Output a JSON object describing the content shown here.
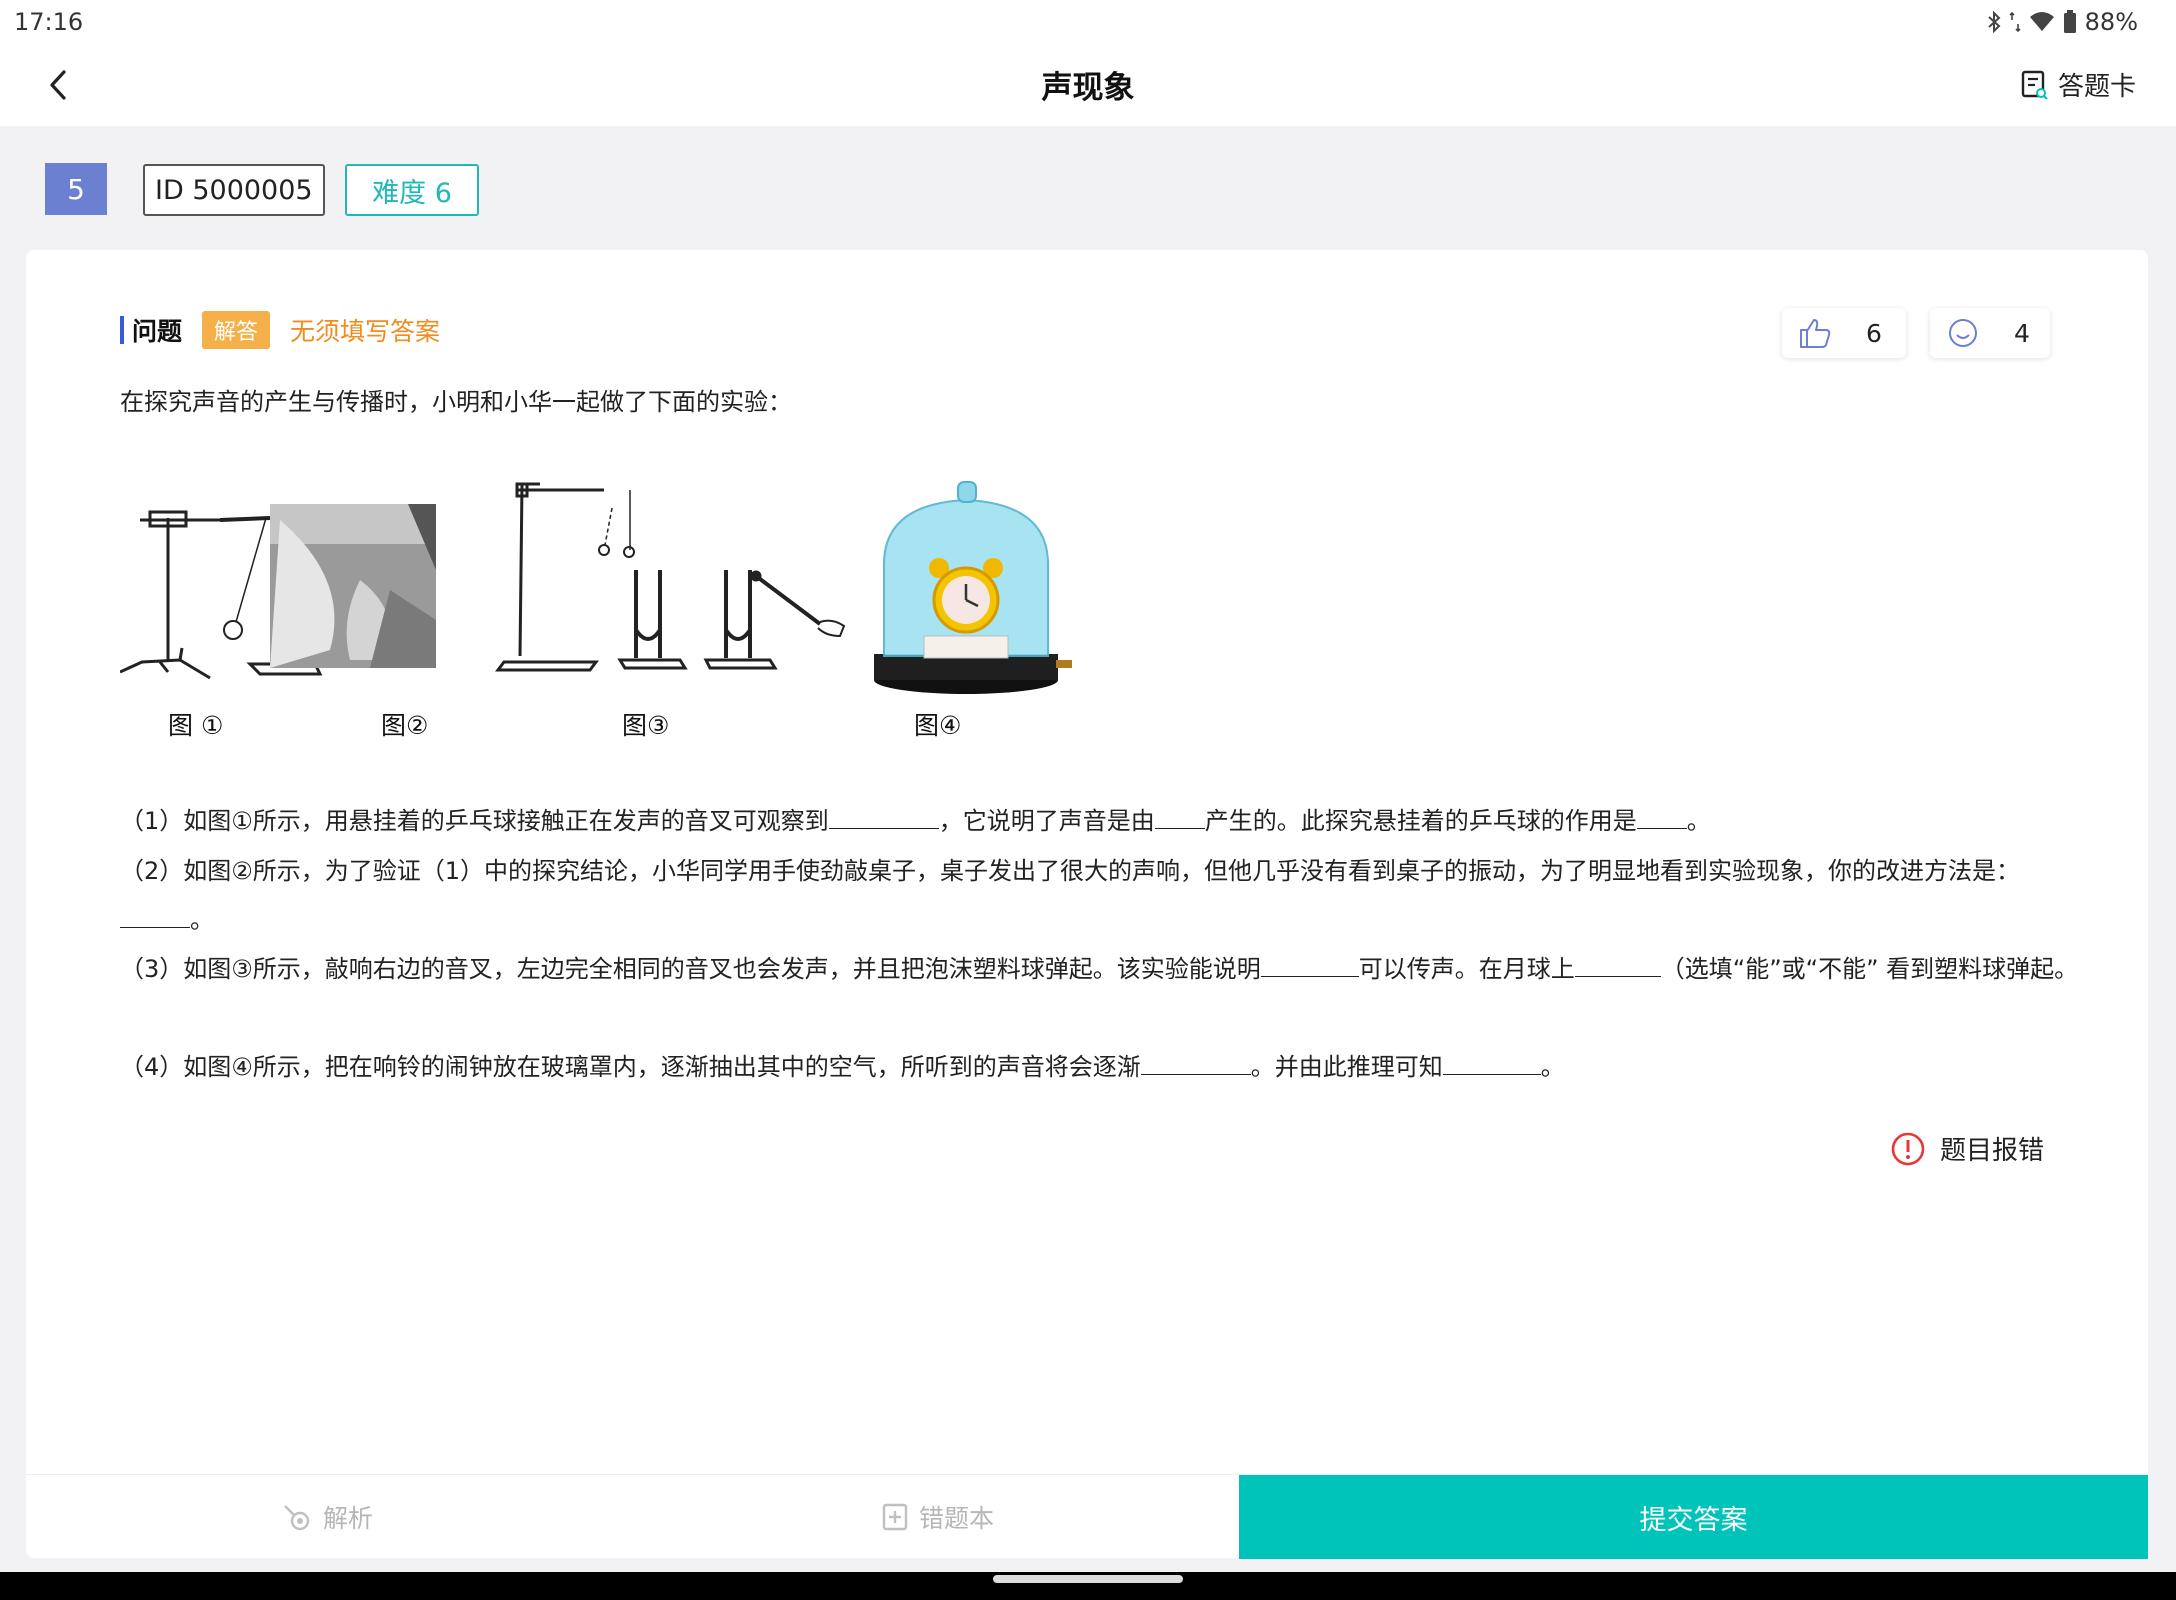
{
  "status_bar": {
    "time": "17:16",
    "battery": "88%"
  },
  "header": {
    "title": "声现象",
    "answer_card_label": "答题卡"
  },
  "meta": {
    "number": "5",
    "id_label": "ID 5000005",
    "difficulty_label": "难度 6"
  },
  "question": {
    "section_label": "问题",
    "type_tag": "解答",
    "note": "无须填写答案",
    "likes": "6",
    "reactions": "4",
    "intro": "在探究声音的产生与传播时，小明和小华一起做了下面的实验：",
    "figure_captions": [
      "图 ①",
      "图②",
      "图③",
      "图④"
    ],
    "parts": {
      "p1": {
        "a": "（1）如图①所示，用悬挂着的乒乓球接触正在发声的音叉可观察到",
        "b": "，它说明了声音是由",
        "c": "产生的。此探究悬挂着的乒乓球的作用是",
        "d": "。"
      },
      "p2": {
        "a": "（2）如图②所示，为了验证（1）中的探究结论，小华同学用手使劲敲桌子，桌子发出了很大的声响，但他几乎没有看到桌子的振动，为了明显地看到实验现象，你的改进方法是：",
        "b": "。"
      },
      "p3": {
        "a": "（3）如图③所示，敲响右边的音叉，左边完全相同的音叉也会发声，并且把泡沫塑料球弹起。该实验能说明",
        "b": "可以传声。在月球上",
        "c": "（选填“能”或“不能” 看到塑料球弹起。"
      },
      "p4": {
        "a": "（4）如图④所示，把在响铃的闹钟放在玻璃罩内，逐渐抽出其中的空气，所听到的声音将会逐渐",
        "b": "。并由此推理可知",
        "c": "。"
      }
    },
    "report_label": "题目报错"
  },
  "bottom_bar": {
    "analysis_label": "解析",
    "wrongbook_label": "错题本",
    "submit_label": "提交答案"
  },
  "colors": {
    "accent": "#00c3b9",
    "number_badge": "#6b80d0",
    "tag": "#f5b04a",
    "note": "#f08c1c",
    "report": "#e53935"
  }
}
